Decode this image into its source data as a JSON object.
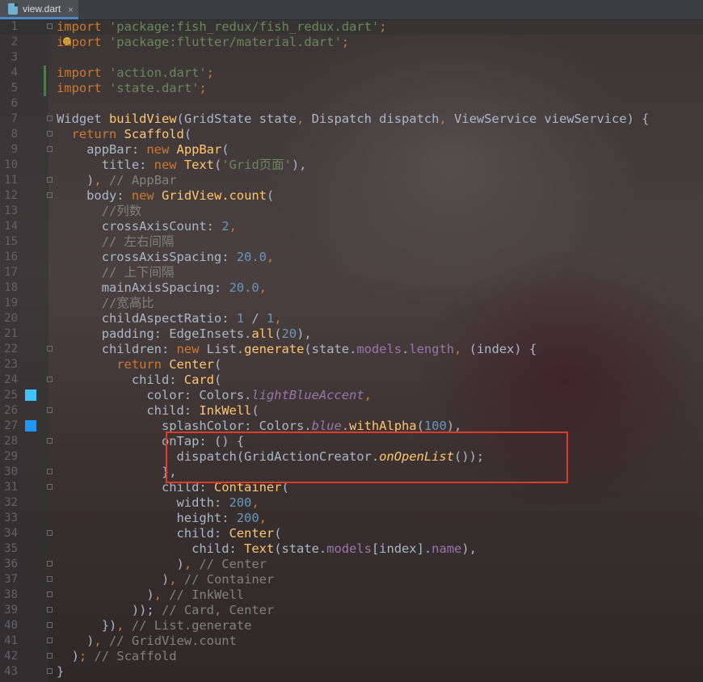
{
  "editor": {
    "tab": {
      "title": "view.dart",
      "close_glyph": "×",
      "icon": "dart-file-icon"
    },
    "highlight_color": "#e03a2a",
    "current_line": 1,
    "gutter_markers": [
      {
        "line": 25,
        "type": "color-swatch",
        "color": "#40c4ff"
      },
      {
        "line": 27,
        "type": "color-swatch",
        "color": "#2196f3"
      }
    ],
    "lines": [
      {
        "n": "1",
        "tokens": [
          [
            "kw",
            "import"
          ],
          [
            "",
            " "
          ],
          [
            "str",
            "'package:fish_redux/fish_redux.dart'"
          ],
          [
            "kw",
            ";"
          ]
        ]
      },
      {
        "n": "2",
        "tokens": [
          [
            "kw",
            "import"
          ],
          [
            "",
            " "
          ],
          [
            "str",
            "'package:flutter/material.dart'"
          ],
          [
            "kw",
            ";"
          ]
        ]
      },
      {
        "n": "3",
        "tokens": []
      },
      {
        "n": "4",
        "tokens": [
          [
            "kw",
            "import"
          ],
          [
            "",
            " "
          ],
          [
            "str",
            "'action.dart'"
          ],
          [
            "kw",
            ";"
          ]
        ]
      },
      {
        "n": "5",
        "tokens": [
          [
            "kw",
            "import"
          ],
          [
            "",
            " "
          ],
          [
            "str",
            "'state.dart'"
          ],
          [
            "kw",
            ";"
          ]
        ]
      },
      {
        "n": "6",
        "tokens": []
      },
      {
        "n": "7",
        "tokens": [
          [
            "cls",
            "Widget "
          ],
          [
            "fn",
            "buildView"
          ],
          [
            "",
            "(GridState state"
          ],
          [
            "kw",
            ", "
          ],
          [
            "",
            "Dispatch dispatch"
          ],
          [
            "kw",
            ", "
          ],
          [
            "",
            "ViewService viewService) {"
          ]
        ]
      },
      {
        "n": "8",
        "tokens": [
          [
            "",
            "  "
          ],
          [
            "kw",
            "return "
          ],
          [
            "fn",
            "Scaffold"
          ],
          [
            "",
            "("
          ]
        ]
      },
      {
        "n": "9",
        "tokens": [
          [
            "",
            "    appBar: "
          ],
          [
            "kw",
            "new "
          ],
          [
            "fn",
            "AppBar"
          ],
          [
            "",
            "("
          ]
        ]
      },
      {
        "n": "10",
        "tokens": [
          [
            "",
            "      title: "
          ],
          [
            "kw",
            "new "
          ],
          [
            "fn",
            "Text"
          ],
          [
            "",
            "("
          ],
          [
            "str",
            "'Grid页面'"
          ],
          [
            "",
            "),"
          ]
        ]
      },
      {
        "n": "11",
        "tokens": [
          [
            "",
            "    )"
          ],
          [
            "kw",
            ", "
          ],
          [
            "cm",
            "// AppBar"
          ]
        ]
      },
      {
        "n": "12",
        "tokens": [
          [
            "",
            "    body: "
          ],
          [
            "kw",
            "new "
          ],
          [
            "fn",
            "GridView.count"
          ],
          [
            "",
            "("
          ]
        ]
      },
      {
        "n": "13",
        "tokens": [
          [
            "",
            "      "
          ],
          [
            "cm",
            "//列数"
          ]
        ]
      },
      {
        "n": "14",
        "tokens": [
          [
            "",
            "      crossAxisCount: "
          ],
          [
            "num",
            "2"
          ],
          [
            "kw",
            ","
          ]
        ]
      },
      {
        "n": "15",
        "tokens": [
          [
            "",
            "      "
          ],
          [
            "cm",
            "// 左右间隔"
          ]
        ]
      },
      {
        "n": "16",
        "tokens": [
          [
            "",
            "      crossAxisSpacing: "
          ],
          [
            "num",
            "20.0"
          ],
          [
            "kw",
            ","
          ]
        ]
      },
      {
        "n": "17",
        "tokens": [
          [
            "",
            "      "
          ],
          [
            "cm",
            "// 上下间隔"
          ]
        ]
      },
      {
        "n": "18",
        "tokens": [
          [
            "",
            "      mainAxisSpacing: "
          ],
          [
            "num",
            "20.0"
          ],
          [
            "kw",
            ","
          ]
        ]
      },
      {
        "n": "19",
        "tokens": [
          [
            "",
            "      "
          ],
          [
            "cm",
            "//宽高比"
          ]
        ]
      },
      {
        "n": "20",
        "tokens": [
          [
            "",
            "      childAspectRatio: "
          ],
          [
            "num",
            "1"
          ],
          [
            "",
            " / "
          ],
          [
            "num",
            "1"
          ],
          [
            "kw",
            ","
          ]
        ]
      },
      {
        "n": "21",
        "tokens": [
          [
            "",
            "      padding: EdgeInsets."
          ],
          [
            "fn",
            "all"
          ],
          [
            "",
            "("
          ],
          [
            "num",
            "20"
          ],
          [
            "",
            "),"
          ]
        ]
      },
      {
        "n": "22",
        "tokens": [
          [
            "",
            "      children: "
          ],
          [
            "kw",
            "new "
          ],
          [
            "",
            "List."
          ],
          [
            "fn",
            "generate"
          ],
          [
            "",
            "(state."
          ],
          [
            "fld",
            "models"
          ],
          [
            "",
            "."
          ],
          [
            "fld",
            "length"
          ],
          [
            "kw",
            ", "
          ],
          [
            "",
            "(index) {"
          ]
        ]
      },
      {
        "n": "23",
        "tokens": [
          [
            "",
            "        "
          ],
          [
            "kw",
            "return "
          ],
          [
            "fn",
            "Center"
          ],
          [
            "",
            "("
          ]
        ]
      },
      {
        "n": "24",
        "tokens": [
          [
            "",
            "          child: "
          ],
          [
            "fn",
            "Card"
          ],
          [
            "",
            "("
          ]
        ]
      },
      {
        "n": "25",
        "tokens": [
          [
            "",
            "            color: Colors."
          ],
          [
            "fldit",
            "lightBlueAccent"
          ],
          [
            "kw",
            ","
          ]
        ]
      },
      {
        "n": "26",
        "tokens": [
          [
            "",
            "            child: "
          ],
          [
            "fn",
            "InkWell"
          ],
          [
            "",
            "("
          ]
        ]
      },
      {
        "n": "27",
        "tokens": [
          [
            "",
            "              splashColor: Colors."
          ],
          [
            "fldit",
            "blue"
          ],
          [
            "",
            "."
          ],
          [
            "fn",
            "withAlpha"
          ],
          [
            "",
            "("
          ],
          [
            "num",
            "100"
          ],
          [
            "",
            "),"
          ]
        ]
      },
      {
        "n": "28",
        "tokens": [
          [
            "",
            "              onTap: () {"
          ]
        ]
      },
      {
        "n": "29",
        "tokens": [
          [
            "",
            "                dispatch(GridActionCreator."
          ],
          [
            "fnit",
            "onOpenList"
          ],
          [
            "",
            "());"
          ]
        ]
      },
      {
        "n": "30",
        "tokens": [
          [
            "",
            "              },"
          ]
        ]
      },
      {
        "n": "31",
        "tokens": [
          [
            "",
            "              child: "
          ],
          [
            "fn",
            "Container"
          ],
          [
            "",
            "("
          ]
        ]
      },
      {
        "n": "32",
        "tokens": [
          [
            "",
            "                width: "
          ],
          [
            "num",
            "200"
          ],
          [
            "kw",
            ","
          ]
        ]
      },
      {
        "n": "33",
        "tokens": [
          [
            "",
            "                height: "
          ],
          [
            "num",
            "200"
          ],
          [
            "kw",
            ","
          ]
        ]
      },
      {
        "n": "34",
        "tokens": [
          [
            "",
            "                child: "
          ],
          [
            "fn",
            "Center"
          ],
          [
            "",
            "("
          ]
        ]
      },
      {
        "n": "35",
        "tokens": [
          [
            "",
            "                  child: "
          ],
          [
            "fn",
            "Text"
          ],
          [
            "",
            "(state."
          ],
          [
            "fld",
            "models"
          ],
          [
            "",
            "[index]."
          ],
          [
            "fld",
            "name"
          ],
          [
            "",
            "),"
          ]
        ]
      },
      {
        "n": "36",
        "tokens": [
          [
            "",
            "                )"
          ],
          [
            "kw",
            ", "
          ],
          [
            "cm",
            "// Center"
          ]
        ]
      },
      {
        "n": "37",
        "tokens": [
          [
            "",
            "              )"
          ],
          [
            "kw",
            ", "
          ],
          [
            "cm",
            "// Container"
          ]
        ]
      },
      {
        "n": "38",
        "tokens": [
          [
            "",
            "            )"
          ],
          [
            "kw",
            ", "
          ],
          [
            "cm",
            "// InkWell"
          ]
        ]
      },
      {
        "n": "39",
        "tokens": [
          [
            "",
            "          ));"
          ],
          [
            "",
            " "
          ],
          [
            "cm",
            "// Card, Center"
          ]
        ]
      },
      {
        "n": "40",
        "tokens": [
          [
            "",
            "      })"
          ],
          [
            "kw",
            ", "
          ],
          [
            "cm",
            "// List.generate"
          ]
        ]
      },
      {
        "n": "41",
        "tokens": [
          [
            "",
            "    )"
          ],
          [
            "kw",
            ", "
          ],
          [
            "cm",
            "// GridView.count"
          ]
        ]
      },
      {
        "n": "42",
        "tokens": [
          [
            "",
            "  )"
          ],
          [
            "kw",
            "; "
          ],
          [
            "cm",
            "// Scaffold"
          ]
        ]
      },
      {
        "n": "43",
        "tokens": [
          [
            "",
            "}"
          ]
        ]
      }
    ]
  }
}
